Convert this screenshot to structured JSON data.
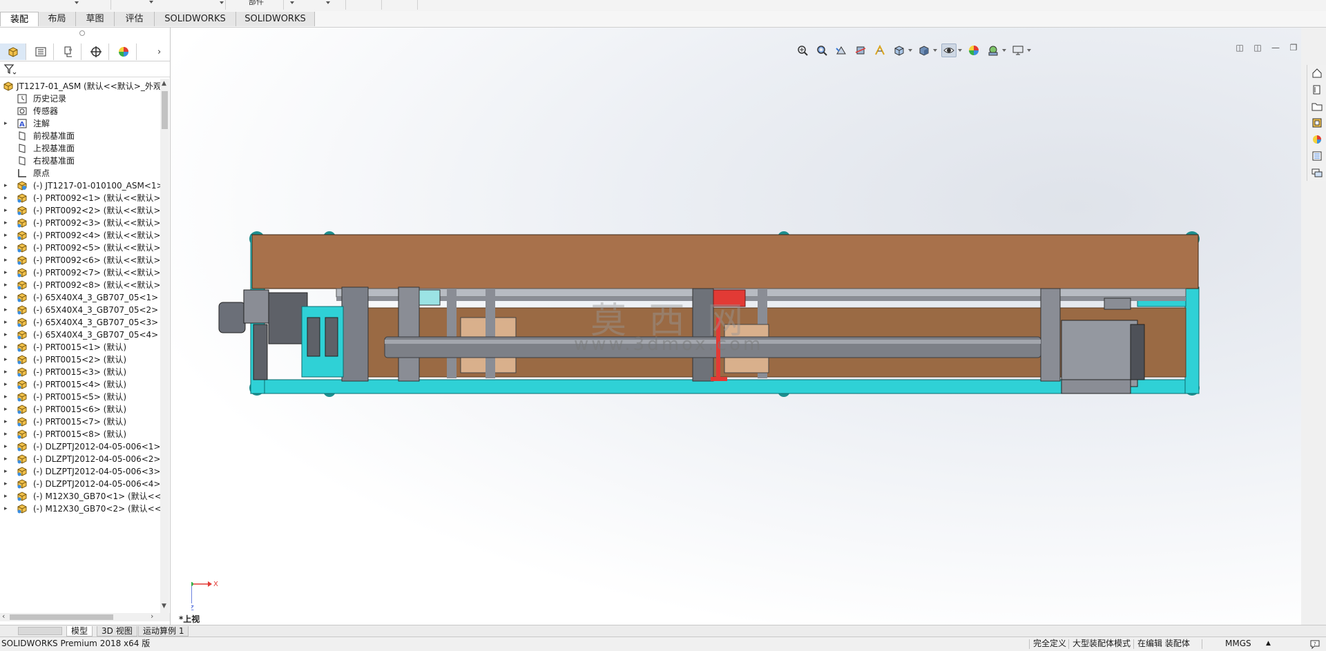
{
  "top_strip": {
    "partial_label": "部件"
  },
  "tabs": [
    {
      "label": "装配体",
      "active": true
    },
    {
      "label": "布局"
    },
    {
      "label": "草图"
    },
    {
      "label": "评估"
    },
    {
      "label": "SOLIDWORKS 插件"
    },
    {
      "label": "SOLIDWORKS MBD"
    }
  ],
  "feature_tree": {
    "root": "JT1217-01_ASM  (默认<<默认>_外观",
    "items": [
      {
        "label": "历史记录",
        "icon": "history-icon",
        "expandable": false
      },
      {
        "label": "传感器",
        "icon": "sensor-icon",
        "expandable": false
      },
      {
        "label": "注解",
        "icon": "annotation-icon",
        "expandable": true
      },
      {
        "label": "前视基准面",
        "icon": "plane-icon",
        "expandable": false
      },
      {
        "label": "上视基准面",
        "icon": "plane-icon",
        "expandable": false
      },
      {
        "label": "右视基准面",
        "icon": "plane-icon",
        "expandable": false
      },
      {
        "label": "原点",
        "icon": "origin-icon",
        "expandable": false
      },
      {
        "label": "(-) JT1217-01-010100_ASM<1>",
        "icon": "subassembly-icon",
        "expandable": true
      },
      {
        "label": "(-) PRT0092<1> (默认<<默认>_显",
        "icon": "part-icon",
        "expandable": true
      },
      {
        "label": "(-) PRT0092<2> (默认<<默认>_显",
        "icon": "part-icon",
        "expandable": true
      },
      {
        "label": "(-) PRT0092<3> (默认<<默认>_显",
        "icon": "part-icon",
        "expandable": true
      },
      {
        "label": "(-) PRT0092<4> (默认<<默认>_显",
        "icon": "part-icon",
        "expandable": true
      },
      {
        "label": "(-) PRT0092<5> (默认<<默认>_显",
        "icon": "part-icon",
        "expandable": true
      },
      {
        "label": "(-) PRT0092<6> (默认<<默认>_显",
        "icon": "part-icon",
        "expandable": true
      },
      {
        "label": "(-) PRT0092<7> (默认<<默认>_显",
        "icon": "part-icon",
        "expandable": true
      },
      {
        "label": "(-) PRT0092<8> (默认<<默认>_显",
        "icon": "part-icon",
        "expandable": true
      },
      {
        "label": "(-) 65X40X4_3_GB707_05<1> (默",
        "icon": "part-icon",
        "expandable": true
      },
      {
        "label": "(-) 65X40X4_3_GB707_05<2> (默",
        "icon": "part-icon",
        "expandable": true
      },
      {
        "label": "(-) 65X40X4_3_GB707_05<3> (默",
        "icon": "part-icon",
        "expandable": true
      },
      {
        "label": "(-) 65X40X4_3_GB707_05<4> (默",
        "icon": "part-icon",
        "expandable": true
      },
      {
        "label": "(-) PRT0015<1> (默认)",
        "icon": "part-icon",
        "expandable": true
      },
      {
        "label": "(-) PRT0015<2> (默认)",
        "icon": "part-icon",
        "expandable": true
      },
      {
        "label": "(-) PRT0015<3> (默认)",
        "icon": "part-icon",
        "expandable": true
      },
      {
        "label": "(-) PRT0015<4> (默认)",
        "icon": "part-icon",
        "expandable": true
      },
      {
        "label": "(-) PRT0015<5> (默认)",
        "icon": "part-icon",
        "expandable": true
      },
      {
        "label": "(-) PRT0015<6> (默认)",
        "icon": "part-icon",
        "expandable": true
      },
      {
        "label": "(-) PRT0015<7> (默认)",
        "icon": "part-icon",
        "expandable": true
      },
      {
        "label": "(-) PRT0015<8> (默认)",
        "icon": "part-icon",
        "expandable": true
      },
      {
        "label": "(-) DLZPTJ2012-04-05-006<1> (",
        "icon": "part-icon",
        "expandable": true
      },
      {
        "label": "(-) DLZPTJ2012-04-05-006<2> (",
        "icon": "part-icon",
        "expandable": true
      },
      {
        "label": "(-) DLZPTJ2012-04-05-006<3> (",
        "icon": "part-icon",
        "expandable": true
      },
      {
        "label": "(-) DLZPTJ2012-04-05-006<4> (",
        "icon": "part-icon",
        "expandable": true
      },
      {
        "label": "(-) M12X30_GB70<1> (默认<<默",
        "icon": "part-icon",
        "expandable": true
      },
      {
        "label": "(-) M12X30_GB70<2> (默认<<默",
        "icon": "part-icon",
        "expandable": true
      }
    ]
  },
  "viewport": {
    "view_name": "*上视",
    "watermark_cn": "莫 西 网",
    "watermark_url": "www.3dmox.com",
    "axis_x": "X",
    "axis_z": "Z",
    "colors": {
      "frame": "#2fd1d6",
      "board": "#a8714b",
      "steel": "#8a8d95",
      "red": "#e23a35",
      "motor": "#6b6f78"
    }
  },
  "bottom_tabs": [
    {
      "label": "模型",
      "active": true
    },
    {
      "label": "3D 视图"
    },
    {
      "label": "运动算例 1"
    }
  ],
  "status_bar": {
    "app": "SOLIDWORKS Premium 2018 x64 版",
    "state1": "完全定义",
    "state2": "大型装配体模式",
    "state3": "在编辑 装配体",
    "units": "MMGS"
  }
}
